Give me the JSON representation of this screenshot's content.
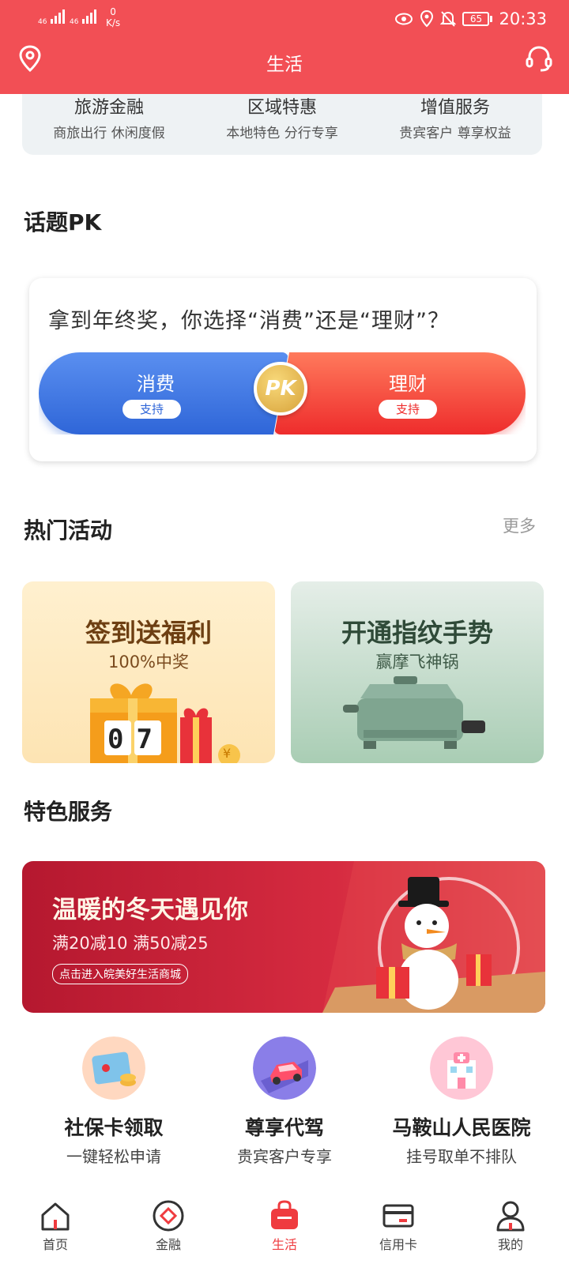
{
  "status_bar": {
    "net1": "46",
    "net2": "46",
    "speed_value": "0",
    "speed_unit": "K/s",
    "battery": "65",
    "time": "20:33"
  },
  "header": {
    "title": "生活"
  },
  "quick_services": [
    {
      "title": "旅游金融",
      "subtitle": "商旅出行 休闲度假"
    },
    {
      "title": "区域特惠",
      "subtitle": "本地特色 分行专享"
    },
    {
      "title": "增值服务",
      "subtitle": "贵宾客户 尊享权益"
    }
  ],
  "topic_pk": {
    "section_title": "话题PK",
    "question": "拿到年终奖，你选择“消费”还是“理财”？",
    "left_option": "消费",
    "right_option": "理财",
    "support_label": "支持",
    "badge": "PK"
  },
  "hot_activities": {
    "section_title": "热门活动",
    "more_label": "更多",
    "items": [
      {
        "title": "签到送福利",
        "subtitle": "100%中奖",
        "counter": "07",
        "coin": "¥"
      },
      {
        "title": "开通指纹手势",
        "subtitle": "赢摩飞神锅"
      }
    ]
  },
  "featured": {
    "section_title": "特色服务",
    "banner_title": "温暖的冬天遇见你",
    "banner_subtitle": "满20减10 满50减25",
    "banner_button": "点击进入皖美好生活商城"
  },
  "services": [
    {
      "title": "社保卡领取",
      "subtitle": "一键轻松申请"
    },
    {
      "title": "尊享代驾",
      "subtitle": "贵宾客户专享"
    },
    {
      "title": "马鞍山人民医院",
      "subtitle": "挂号取单不排队"
    }
  ],
  "tabs": [
    {
      "label": "首页"
    },
    {
      "label": "金融"
    },
    {
      "label": "生活"
    },
    {
      "label": "信用卡"
    },
    {
      "label": "我的"
    }
  ],
  "colors": {
    "brand_red": "#f24f55",
    "tab_active": "#ef3b3f",
    "pk_blue": "#2f66d8",
    "pk_red": "#ee2c2c"
  }
}
